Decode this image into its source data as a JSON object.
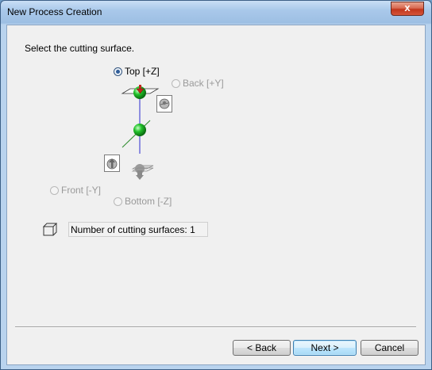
{
  "window": {
    "title": "New Process Creation",
    "close_glyph": "x"
  },
  "prompt": "Select the cutting surface.",
  "surfaces": {
    "top": {
      "label": "Top [+Z]",
      "selected": true,
      "enabled": true
    },
    "back": {
      "label": "Back [+Y]",
      "selected": false,
      "enabled": false
    },
    "front": {
      "label": "Front [-Y]",
      "selected": false,
      "enabled": false
    },
    "bottom": {
      "label": "Bottom [-Z]",
      "selected": false,
      "enabled": false
    }
  },
  "count": {
    "text": "Number of cutting surfaces: 1",
    "icon": "cube-outline-icon"
  },
  "buttons": {
    "back": "< Back",
    "next": "Next >",
    "cancel": "Cancel"
  },
  "colors": {
    "sphere": "#22c22a",
    "z_axis": "#2b2bd0",
    "y_axis": "#2a8a2a",
    "arrow": "#c0281c"
  }
}
